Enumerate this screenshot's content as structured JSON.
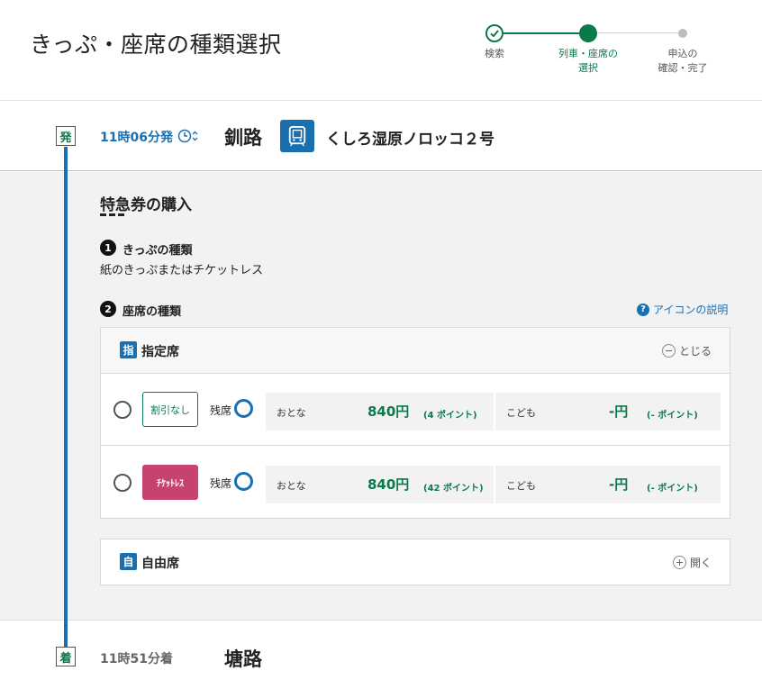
{
  "header": {
    "title": "きっぷ・座席の種類選択",
    "steps": [
      {
        "label": "検索",
        "state": "done"
      },
      {
        "label": "列車・座席の\n選択",
        "state": "current"
      },
      {
        "label": "申込の\n確認・完了",
        "state": "todo"
      }
    ]
  },
  "departure": {
    "badge": "発",
    "time": "11時06分発",
    "station": "釧路",
    "train_name": "くしろ湿原ノロッコ２号"
  },
  "purchase": {
    "title": "特急券の購入",
    "ticket_type": {
      "number": "1",
      "label": "きっぷの種類",
      "value": "紙のきっぷまたはチケットレス"
    },
    "seat_type": {
      "number": "2",
      "label": "座席の種類",
      "help_link": "アイコンの説明"
    }
  },
  "reserved": {
    "icon_char": "指",
    "label": "指定席",
    "toggle": "とじる",
    "rows": [
      {
        "type_label": "割引なし",
        "remain_label": "残席",
        "adult_label": "おとな",
        "adult_price": "840円",
        "adult_points": "(4 ポイント)",
        "child_label": "こども",
        "child_price": "-円",
        "child_points": "(- ポイント)"
      },
      {
        "type_label": "ﾁｹｯﾄﾚｽ",
        "remain_label": "残席",
        "adult_label": "おとな",
        "adult_price": "840円",
        "adult_points": "(42 ポイント)",
        "child_label": "こども",
        "child_price": "-円",
        "child_points": "(- ポイント)"
      }
    ]
  },
  "free": {
    "icon_char": "自",
    "label": "自由席",
    "toggle": "開く"
  },
  "arrival": {
    "badge": "着",
    "time": "11時51分着",
    "station": "塘路"
  },
  "colors": {
    "green": "#0b7a4a",
    "blue": "#1a6fb0",
    "ticketless": "#c8426f"
  }
}
